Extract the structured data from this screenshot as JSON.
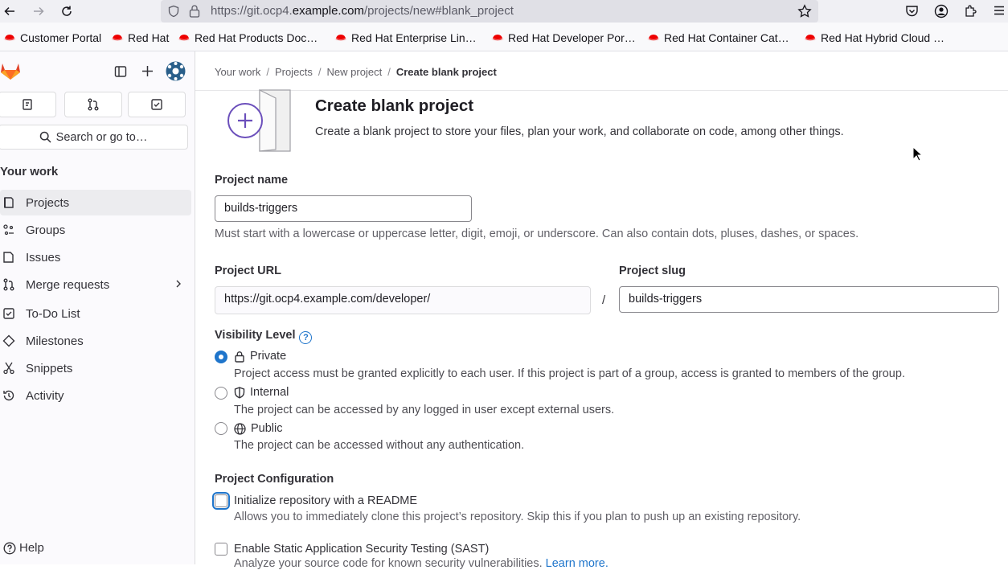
{
  "browser": {
    "url_prefix": "https://git.ocp4.",
    "url_domain": "example.com",
    "url_path": "/projects/new#blank_project",
    "bookmarks": [
      {
        "label": "Customer Portal"
      },
      {
        "label": "Red Hat"
      },
      {
        "label": "Red Hat Products Doc…"
      },
      {
        "label": "Red Hat Enterprise Lin…"
      },
      {
        "label": "Red Hat Developer Por…"
      },
      {
        "label": "Red Hat Container Cat…"
      },
      {
        "label": "Red Hat Hybrid Cloud …"
      }
    ]
  },
  "sidebar": {
    "search_label": "Search or go to…",
    "section_title": "Your work",
    "items": [
      {
        "label": "Projects",
        "icon": "project-icon",
        "active": true
      },
      {
        "label": "Groups",
        "icon": "group-icon"
      },
      {
        "label": "Issues",
        "icon": "issues-icon"
      },
      {
        "label": "Merge requests",
        "icon": "merge-request-icon"
      },
      {
        "label": "To-Do List",
        "icon": "todo-icon"
      },
      {
        "label": "Milestones",
        "icon": "milestone-icon"
      },
      {
        "label": "Snippets",
        "icon": "snippet-icon"
      },
      {
        "label": "Activity",
        "icon": "history-icon"
      }
    ],
    "help_label": "Help"
  },
  "breadcrumb": {
    "items": [
      "Your work",
      "Projects",
      "New project",
      "Create blank project"
    ]
  },
  "header": {
    "title": "Create blank project",
    "description": "Create a blank project to store your files, plan your work, and collaborate on code, among other things."
  },
  "form": {
    "project_name_label": "Project name",
    "project_name_value": "builds-triggers",
    "project_name_help": "Must start with a lowercase or uppercase letter, digit, emoji, or underscore. Can also contain dots, pluses, dashes, or spaces.",
    "project_url_label": "Project URL",
    "project_url_value": "https://git.ocp4.example.com/developer/",
    "separator": "/",
    "project_slug_label": "Project slug",
    "project_slug_value": "builds-triggers",
    "visibility_label": "Visibility Level",
    "visibility_options": [
      {
        "label": "Private",
        "icon": "lock-icon",
        "selected": true,
        "description": "Project access must be granted explicitly to each user. If this project is part of a group, access is granted to members of the group."
      },
      {
        "label": "Internal",
        "icon": "shield-icon",
        "selected": false,
        "description": "The project can be accessed by any logged in user except external users."
      },
      {
        "label": "Public",
        "icon": "earth-icon",
        "selected": false,
        "description": "The project can be accessed without any authentication."
      }
    ],
    "config_label": "Project Configuration",
    "readme_label": "Initialize repository with a README",
    "readme_checked": false,
    "readme_description": "Allows you to immediately clone this project’s repository. Skip this if you plan to push up an existing repository.",
    "sast_label": "Enable Static Application Security Testing (SAST)",
    "sast_checked": false,
    "sast_description": "Analyze your source code for known security vulnerabilities.",
    "sast_link": "Learn more."
  },
  "colors": {
    "accent": "#1f75cb",
    "brand": "#e24329"
  }
}
